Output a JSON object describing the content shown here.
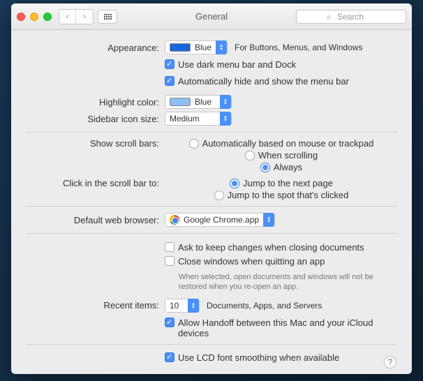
{
  "window": {
    "title": "General"
  },
  "search": {
    "placeholder": "Search"
  },
  "appearance": {
    "label": "Appearance:",
    "value": "Blue",
    "hint": "For Buttons, Menus, and Windows",
    "dark_menu": "Use dark menu bar and Dock",
    "auto_hide": "Automatically hide and show the menu bar"
  },
  "highlight": {
    "label": "Highlight color:",
    "value": "Blue"
  },
  "sidebar_icon": {
    "label": "Sidebar icon size:",
    "value": "Medium"
  },
  "scroll": {
    "label": "Show scroll bars:",
    "opt1": "Automatically based on mouse or trackpad",
    "opt2": "When scrolling",
    "opt3": "Always"
  },
  "click_scroll": {
    "label": "Click in the scroll bar to:",
    "opt1": "Jump to the next page",
    "opt2": "Jump to the spot that's clicked"
  },
  "browser": {
    "label": "Default web browser:",
    "value": "Google Chrome.app"
  },
  "docs": {
    "ask_keep": "Ask to keep changes when closing documents",
    "close_windows": "Close windows when quitting an app",
    "note": "When selected, open documents and windows will not be restored when you re-open an app."
  },
  "recent": {
    "label": "Recent items:",
    "value": "10",
    "hint": "Documents, Apps, and Servers"
  },
  "handoff": {
    "label": "Allow Handoff between this Mac and your iCloud devices"
  },
  "lcd": {
    "label": "Use LCD font smoothing when available"
  }
}
